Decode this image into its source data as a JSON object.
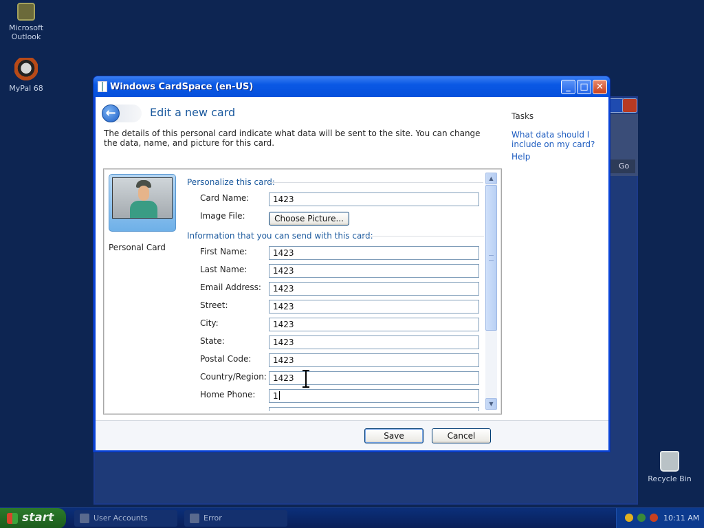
{
  "desktop": {
    "icons": [
      {
        "label": "Microsoft Outlook"
      },
      {
        "label": "MyPal 68"
      },
      {
        "label": "Recycle Bin"
      }
    ],
    "background_window": {
      "go_label": "Go"
    }
  },
  "dialog": {
    "title": "Windows CardSpace  (en-US)",
    "page_title": "Edit a new card",
    "description": "The details of this personal card indicate what data will be sent to the site. You can change the data, name, and picture for this card.",
    "tasks": {
      "heading": "Tasks",
      "links": [
        "What data should I include on my card?",
        "Help"
      ]
    },
    "card": {
      "name": "Personal Card"
    },
    "sections": {
      "personalize": "Personalize this card:",
      "info": "Information that you can send with this card:"
    },
    "personalize_fields": {
      "card_name_label": "Card Name:",
      "card_name_value": "1423",
      "image_file_label": "Image File:",
      "choose_picture": "Choose Picture..."
    },
    "info_fields": [
      {
        "label": "First Name:",
        "value": "1423"
      },
      {
        "label": "Last Name:",
        "value": "1423"
      },
      {
        "label": "Email Address:",
        "value": "1423"
      },
      {
        "label": "Street:",
        "value": "1423"
      },
      {
        "label": "City:",
        "value": "1423"
      },
      {
        "label": "State:",
        "value": "1423"
      },
      {
        "label": "Postal Code:",
        "value": "1423"
      },
      {
        "label": "Country/Region:",
        "value": "1423"
      },
      {
        "label": "Home Phone:",
        "value": "1"
      }
    ],
    "buttons": {
      "save": "Save",
      "cancel": "Cancel"
    }
  },
  "taskbar": {
    "start": "start",
    "items": [
      {
        "label": "User Accounts"
      },
      {
        "label": "Error"
      }
    ],
    "clock": "10:11 AM"
  }
}
